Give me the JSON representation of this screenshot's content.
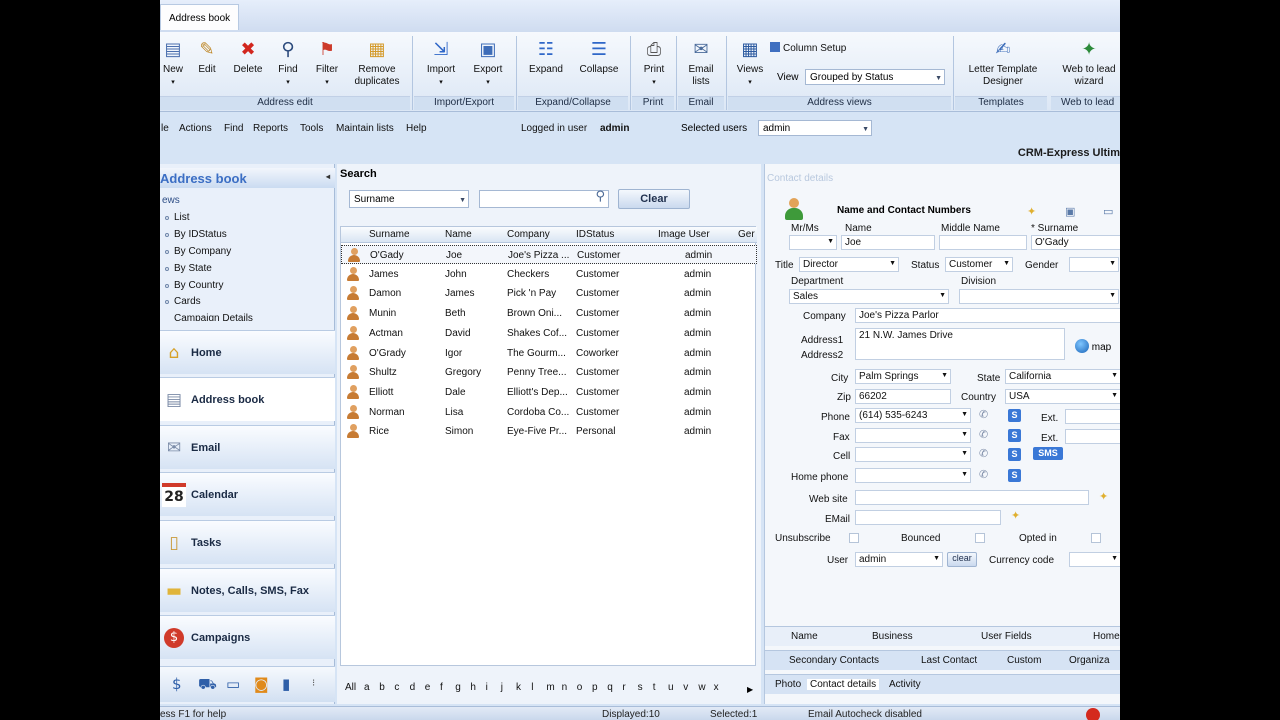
{
  "ribbon_tab": "Address book",
  "ribbon": {
    "buttons": [
      "New",
      "Edit",
      "Delete",
      "Find",
      "Filter",
      "Remove duplicates",
      "Import",
      "Export",
      "Expand",
      "Collapse",
      "Print",
      "Email lists",
      "Views",
      "Letter Template Designer",
      "Web to lead wizard"
    ],
    "column_setup": "Column Setup",
    "view_label": "View",
    "view_value": "Grouped by Status",
    "groups": [
      "Address edit",
      "Import/Export",
      "Expand/Collapse",
      "Print",
      "Email",
      "Address views",
      "Templates",
      "Web to lead"
    ]
  },
  "menu": {
    "items": [
      "le",
      "Actions",
      "Find",
      "Reports",
      "Tools",
      "Maintain lists",
      "Help"
    ],
    "logged_label": "Logged in user",
    "logged_user": "admin",
    "selected_label": "Selected users",
    "selected_value": "admin"
  },
  "product": "CRM-Express Ultim",
  "left": {
    "title": "Address book",
    "views_label": "ews",
    "views": [
      "List",
      "By IDStatus",
      "By Company",
      "By State",
      "By Country",
      "Cards",
      "Campaign Details"
    ],
    "nav": [
      "Home",
      "Address book",
      "Email",
      "Calendar",
      "Tasks",
      "Notes, Calls, SMS, Fax",
      "Campaigns"
    ],
    "calendar_day": "28"
  },
  "search": {
    "title": "Search",
    "field": "Surname",
    "clear": "Clear",
    "columns": [
      "Surname",
      "Name",
      "Company",
      "IDStatus",
      "Image User",
      "Ger"
    ],
    "rows": [
      [
        "O'Gady",
        "Joe",
        "Joe's Pizza ...",
        "Customer",
        "admin"
      ],
      [
        "James",
        "John",
        "Checkers",
        "Customer",
        "admin"
      ],
      [
        "Damon",
        "James",
        "Pick 'n Pay",
        "Customer",
        "admin"
      ],
      [
        "Munin",
        "Beth",
        "Brown Oni...",
        "Customer",
        "admin"
      ],
      [
        "Actman",
        "David",
        "Shakes Cof...",
        "Customer",
        "admin"
      ],
      [
        "O'Grady",
        "Igor",
        "The Gourm...",
        "Coworker",
        "admin"
      ],
      [
        "Shultz",
        "Gregory",
        "Penny Tree...",
        "Customer",
        "admin"
      ],
      [
        "Elliott",
        "Dale",
        "Elliott's Dep...",
        "Customer",
        "admin"
      ],
      [
        "Norman",
        "Lisa",
        "Cordoba Co...",
        "Customer",
        "admin"
      ],
      [
        "Rice",
        "Simon",
        "Eye-Five Pr...",
        "Personal",
        "admin"
      ]
    ],
    "alphabet": [
      "All",
      "a",
      "b",
      "c",
      "d",
      "e",
      "f",
      "g",
      "h",
      "i",
      "j",
      "k",
      "l",
      "m",
      "n",
      "o",
      "p",
      "q",
      "r",
      "s",
      "t",
      "u",
      "v",
      "w",
      "x"
    ]
  },
  "details": {
    "header": "Contact details",
    "section": "Name and Contact Numbers",
    "labels": {
      "mrms": "Mr/Ms",
      "name": "Name",
      "middle": "Middle Name",
      "surname": "* Surname",
      "title": "Title",
      "status": "Status",
      "gender": "Gender",
      "department": "Department",
      "division": "Division",
      "company": "Company",
      "address1": "Address1",
      "address2": "Address2",
      "city": "City",
      "state": "State",
      "zip": "Zip",
      "country": "Country",
      "phone": "Phone",
      "fax": "Fax",
      "cell": "Cell",
      "home": "Home phone",
      "web": "Web site",
      "email": "EMail",
      "ext": "Ext.",
      "unsubscribe": "Unsubscribe",
      "bounced": "Bounced",
      "optin": "Opted in",
      "user": "User",
      "currency": "Currency code"
    },
    "values": {
      "name": "Joe",
      "surname": "O'Gady",
      "title": "Director",
      "status": "Customer",
      "department": "Sales",
      "company": "Joe's Pizza Parlor",
      "address1": "21 N.W. James Drive",
      "city": "Palm Springs",
      "state": "California",
      "zip": "66202",
      "country": "USA",
      "phone": "(614) 535-6243",
      "user": "admin"
    },
    "map": "map",
    "sms": "SMS",
    "s": "S",
    "clear": "clear",
    "tabs1": [
      "Name",
      "Business",
      "User Fields",
      "Home"
    ],
    "tabs2": [
      "Secondary Contacts",
      "Last Contact",
      "Custom",
      "Organiza"
    ],
    "tabs3": [
      "Photo",
      "Contact details",
      "Activity"
    ]
  },
  "status": {
    "help": "ess F1 for help",
    "displayed": "Displayed:10",
    "selected": "Selected:1",
    "autocheck": "Email Autocheck disabled"
  }
}
